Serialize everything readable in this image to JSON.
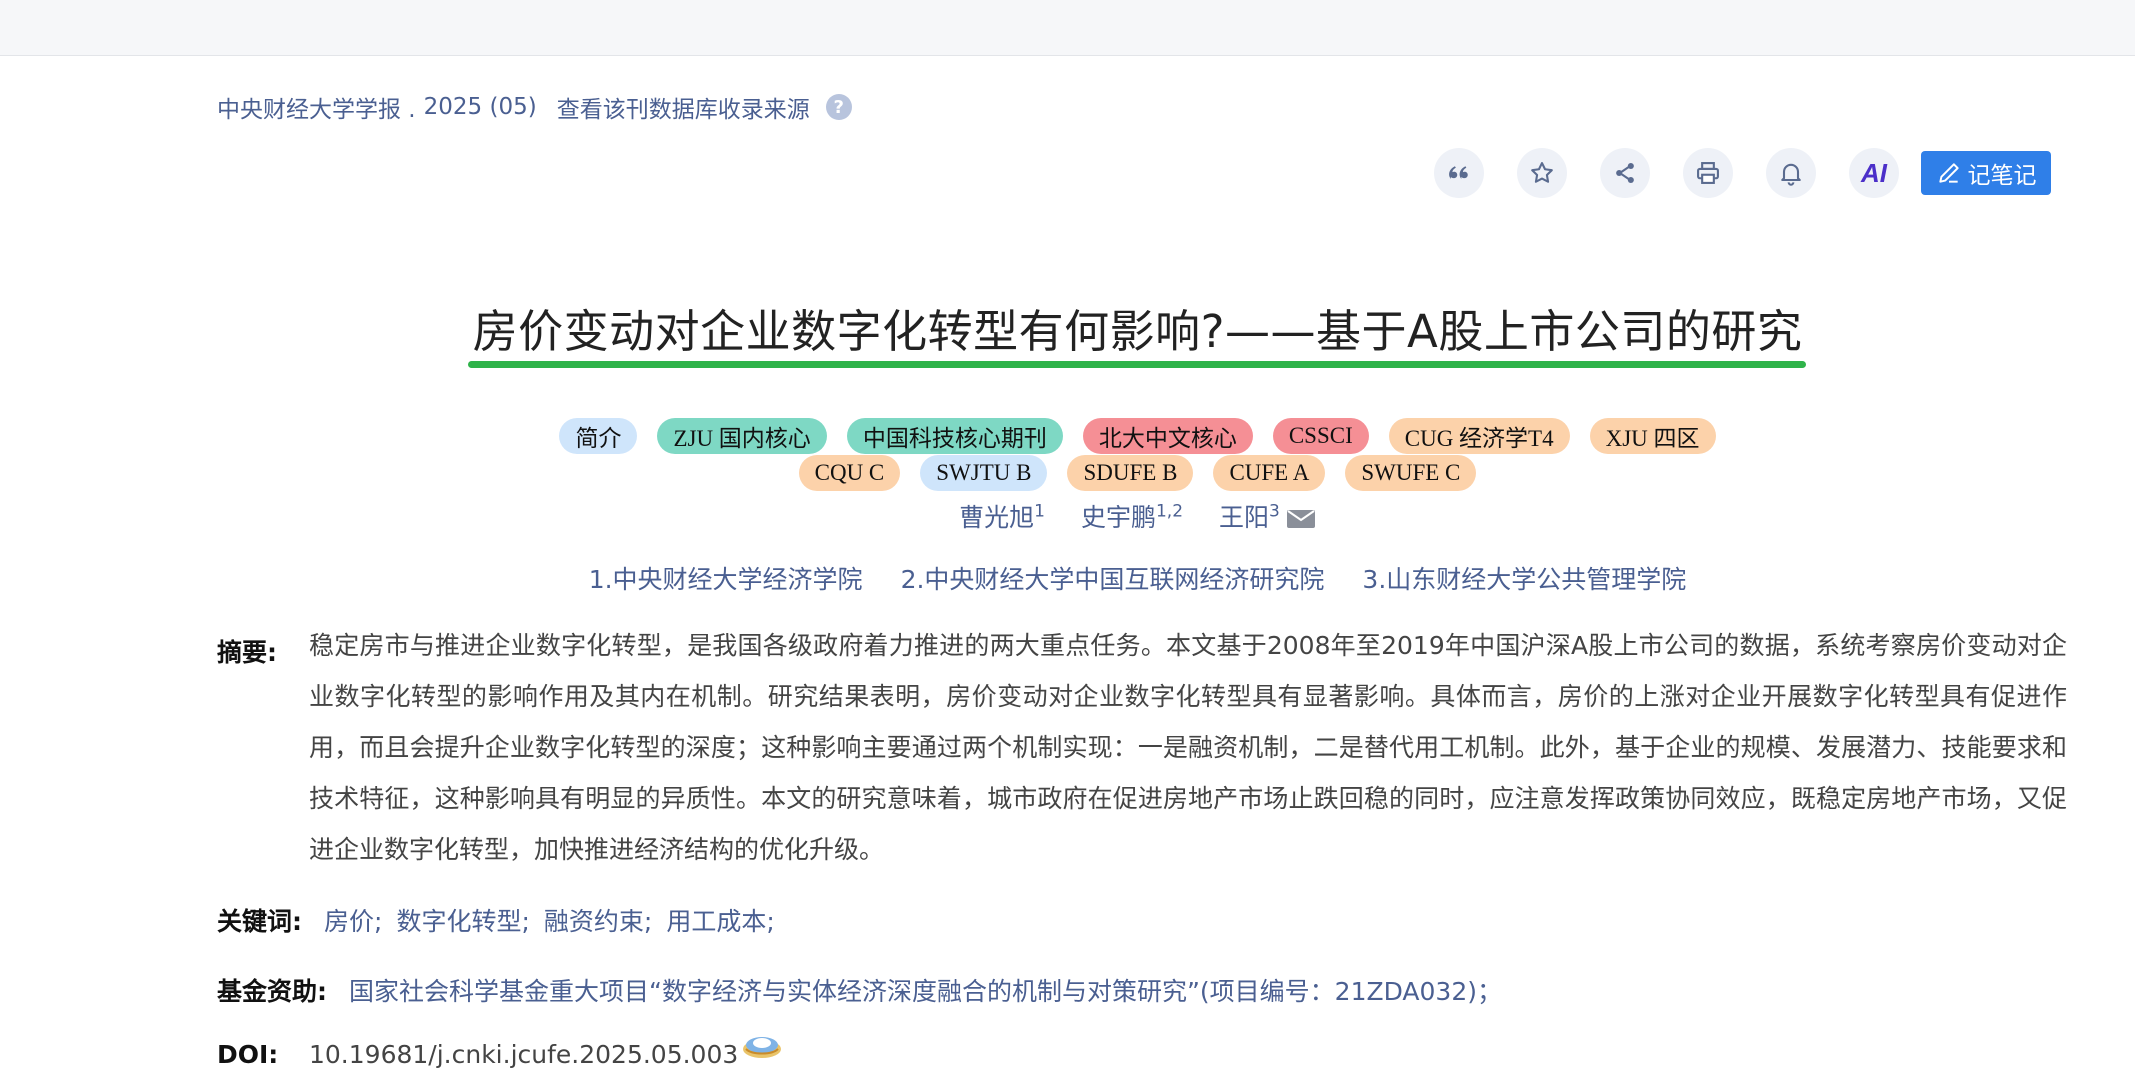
{
  "source": {
    "journal": "中央财经大学学报 .",
    "issue": "2025 (05)",
    "db_link": "查看该刊数据库收录来源",
    "help_icon": "?"
  },
  "toolbar": {
    "icons": [
      "quote-icon",
      "star-icon",
      "share-icon",
      "print-icon",
      "bell-icon",
      "ai-icon"
    ],
    "ai_label": "AI",
    "note_button": "记笔记"
  },
  "title": "房价变动对企业数字化转型有何影响?——基于A股上市公司的研究",
  "tags_row1": [
    {
      "label": "简介",
      "color": "#cfe5fb"
    },
    {
      "label": "ZJU 国内核心",
      "color": "#7ed8c4"
    },
    {
      "label": "中国科技核心期刊",
      "color": "#7ed8c4"
    },
    {
      "label": "北大中文核心",
      "color": "#f58f95"
    },
    {
      "label": "CSSCI",
      "color": "#f58f95"
    },
    {
      "label": "CUG 经济学T4",
      "color": "#fcd2aa"
    },
    {
      "label": "XJU 四区",
      "color": "#fcd2aa"
    }
  ],
  "tags_row2": [
    {
      "label": "CQU C",
      "color": "#fcd2aa"
    },
    {
      "label": "SWJTU B",
      "color": "#cfe5fb"
    },
    {
      "label": "SDUFE B",
      "color": "#fcd2aa"
    },
    {
      "label": "CUFE A",
      "color": "#fcd2aa"
    },
    {
      "label": "SWUFE C",
      "color": "#fcd2aa"
    }
  ],
  "authors": [
    {
      "name": "曹光旭",
      "sup": "1"
    },
    {
      "name": "史宇鹏",
      "sup": "1,2"
    },
    {
      "name": "王阳",
      "sup": "3"
    }
  ],
  "affiliations": [
    "1.中央财经大学经济学院",
    "2.中央财经大学中国互联网经济研究院",
    "3.山东财经大学公共管理学院"
  ],
  "abstract": {
    "label": "摘要:",
    "text": "稳定房市与推进企业数字化转型，是我国各级政府着力推进的两大重点任务。本文基于2008年至2019年中国沪深A股上市公司的数据，系统考察房价变动对企业数字化转型的影响作用及其内在机制。研究结果表明，房价变动对企业数字化转型具有显著影响。具体而言，房价的上涨对企业开展数字化转型具有促进作用，而且会提升企业数字化转型的深度；这种影响主要通过两个机制实现：一是融资机制，二是替代用工机制。此外，基于企业的规模、发展潜力、技能要求和技术特征，这种影响具有明显的异质性。本文的研究意味着，城市政府在促进房地产市场止跌回稳的同时，应注意发挥政策协同效应，既稳定房地产市场，又促进企业数字化转型，加快推进经济结构的优化升级。"
  },
  "keywords": {
    "label": "关键词:",
    "items": [
      "房价;",
      "数字化转型;",
      "融资约束;",
      "用工成本;"
    ]
  },
  "fund": {
    "label": "基金资助:",
    "text": "国家社会科学基金重大项目“数字经济与实体经济深度融合的机制与对策研究”(项目编号：21ZDA032)；"
  },
  "doi": {
    "label": "DOI:",
    "value": "10.19681/j.cnki.jcufe.2025.05.003"
  }
}
